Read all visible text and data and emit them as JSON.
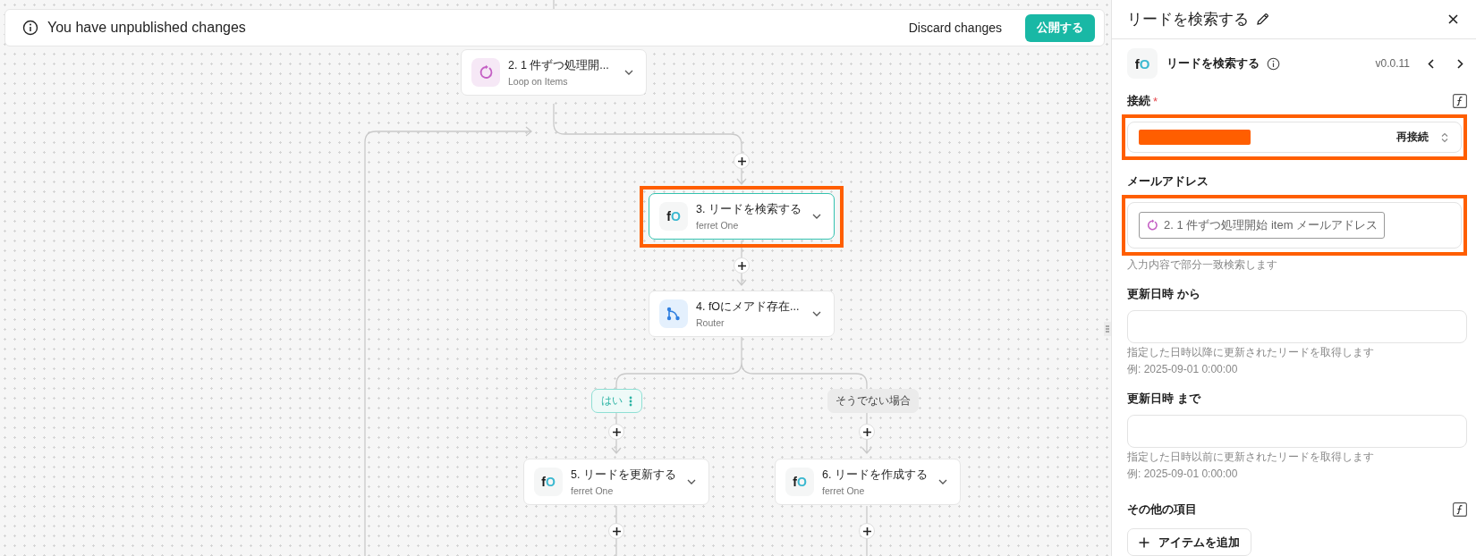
{
  "banner": {
    "message": "You have unpublished changes",
    "discard": "Discard changes",
    "publish": "公開する"
  },
  "flow": {
    "nodes": [
      {
        "kind": "loop",
        "title": "2. 1 件ずつ処理開...",
        "subtitle": "Loop on Items",
        "selected": false,
        "highlighted": false
      },
      {
        "kind": "app",
        "logo": [
          "f",
          "O"
        ],
        "title": "3. リードを検索する",
        "subtitle": "ferret One",
        "selected": true,
        "highlighted": true
      },
      {
        "kind": "router",
        "title": "4. fOにメアド存在...",
        "subtitle": "Router",
        "selected": false,
        "highlighted": false
      },
      {
        "kind": "app",
        "logo": [
          "f",
          "O"
        ],
        "title": "5. リードを更新する",
        "subtitle": "ferret One",
        "selected": false,
        "highlighted": false
      },
      {
        "kind": "app",
        "logo": [
          "f",
          "O"
        ],
        "title": "6. リードを作成する",
        "subtitle": "ferret One",
        "selected": false,
        "highlighted": false
      }
    ],
    "branches": [
      {
        "label": "はい",
        "selected": true
      },
      {
        "label": "そうでない場合",
        "selected": false
      }
    ]
  },
  "panel": {
    "title": "リードを検索する",
    "action": {
      "logo": [
        "f",
        "O"
      ],
      "name": "リードを検索する",
      "version": "v0.0.11"
    },
    "fields": [
      {
        "kind": "connection",
        "label": "接続",
        "required_mark": "*",
        "formula_toggle": true,
        "action": "再接続",
        "highlighted": true
      },
      {
        "kind": "chips",
        "label": "メールアドレス",
        "formula_toggle": false,
        "chip": "2. 1 件ずつ処理開始 item メールアドレス",
        "hints": [
          "入力内容で部分一致検索します"
        ],
        "highlighted": true
      },
      {
        "kind": "text",
        "label": "更新日時 から",
        "formula_toggle": false,
        "hints": [
          "指定した日時以降に更新されたリードを取得します",
          "例: 2025-09-01 0:00:00"
        ],
        "highlighted": false
      },
      {
        "kind": "text",
        "label": "更新日時 まで",
        "formula_toggle": false,
        "hints": [
          "指定した日時以前に更新されたリードを取得します",
          "例: 2025-09-01 0:00:00"
        ],
        "highlighted": false
      }
    ],
    "extra": {
      "label": "その他の項目",
      "formula_toggle": true,
      "button": "アイテムを追加"
    }
  }
}
